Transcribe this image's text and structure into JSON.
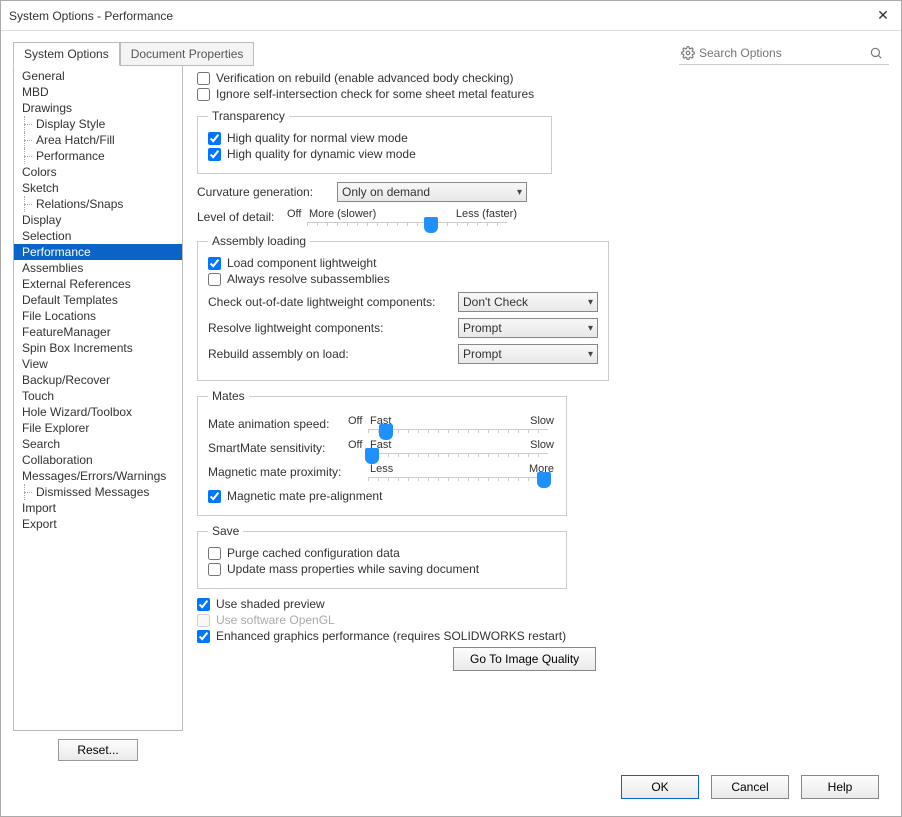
{
  "window": {
    "title": "System Options - Performance"
  },
  "tabs": {
    "system": "System Options",
    "document": "Document Properties"
  },
  "search": {
    "placeholder": "Search Options"
  },
  "nav": {
    "items": [
      {
        "label": "General"
      },
      {
        "label": "MBD"
      },
      {
        "label": "Drawings"
      },
      {
        "label": "Display Style",
        "child": true
      },
      {
        "label": "Area Hatch/Fill",
        "child": true
      },
      {
        "label": "Performance",
        "child": true
      },
      {
        "label": "Colors"
      },
      {
        "label": "Sketch"
      },
      {
        "label": "Relations/Snaps",
        "child": true
      },
      {
        "label": "Display"
      },
      {
        "label": "Selection"
      },
      {
        "label": "Performance",
        "selected": true
      },
      {
        "label": "Assemblies"
      },
      {
        "label": "External References"
      },
      {
        "label": "Default Templates"
      },
      {
        "label": "File Locations"
      },
      {
        "label": "FeatureManager"
      },
      {
        "label": "Spin Box Increments"
      },
      {
        "label": "View"
      },
      {
        "label": "Backup/Recover"
      },
      {
        "label": "Touch"
      },
      {
        "label": "Hole Wizard/Toolbox"
      },
      {
        "label": "File Explorer"
      },
      {
        "label": "Search"
      },
      {
        "label": "Collaboration"
      },
      {
        "label": "Messages/Errors/Warnings"
      },
      {
        "label": "Dismissed Messages",
        "child": true
      },
      {
        "label": "Import"
      },
      {
        "label": "Export"
      }
    ],
    "reset": "Reset..."
  },
  "opts": {
    "verification": "Verification on rebuild (enable advanced body checking)",
    "ignore_self": "Ignore self-intersection check for some sheet metal features",
    "transparency": {
      "legend": "Transparency",
      "hq_normal": "High quality for normal view mode",
      "hq_dynamic": "High quality for dynamic view mode"
    },
    "curvature": {
      "label": "Curvature generation:",
      "value": "Only on demand"
    },
    "lod": {
      "label": "Level of detail:",
      "off": "Off",
      "more": "More (slower)",
      "less": "Less (faster)"
    },
    "assembly": {
      "legend": "Assembly loading",
      "load_lw": "Load component lightweight",
      "resolve_sub": "Always resolve subassemblies",
      "check_ood": {
        "label": "Check out-of-date lightweight components:",
        "value": "Don't Check"
      },
      "resolve_lw": {
        "label": "Resolve lightweight components:",
        "value": "Prompt"
      },
      "rebuild": {
        "label": "Rebuild assembly on load:",
        "value": "Prompt"
      }
    },
    "mates": {
      "legend": "Mates",
      "anim": {
        "label": "Mate animation speed:",
        "off": "Off",
        "fast": "Fast",
        "slow": "Slow"
      },
      "smart": {
        "label": "SmartMate sensitivity:",
        "off": "Off",
        "fast": "Fast",
        "slow": "Slow"
      },
      "magnetic": {
        "label": "Magnetic mate proximity:",
        "less": "Less",
        "more": "More"
      },
      "prealign": "Magnetic mate pre-alignment"
    },
    "save": {
      "legend": "Save",
      "purge": "Purge cached configuration data",
      "mass": "Update mass properties while saving document"
    },
    "shaded": "Use shaded preview",
    "opengl": "Use software OpenGL",
    "enhanced": "Enhanced graphics performance (requires SOLIDWORKS restart)",
    "goto_img": "Go To Image Quality"
  },
  "buttons": {
    "ok": "OK",
    "cancel": "Cancel",
    "help": "Help"
  }
}
